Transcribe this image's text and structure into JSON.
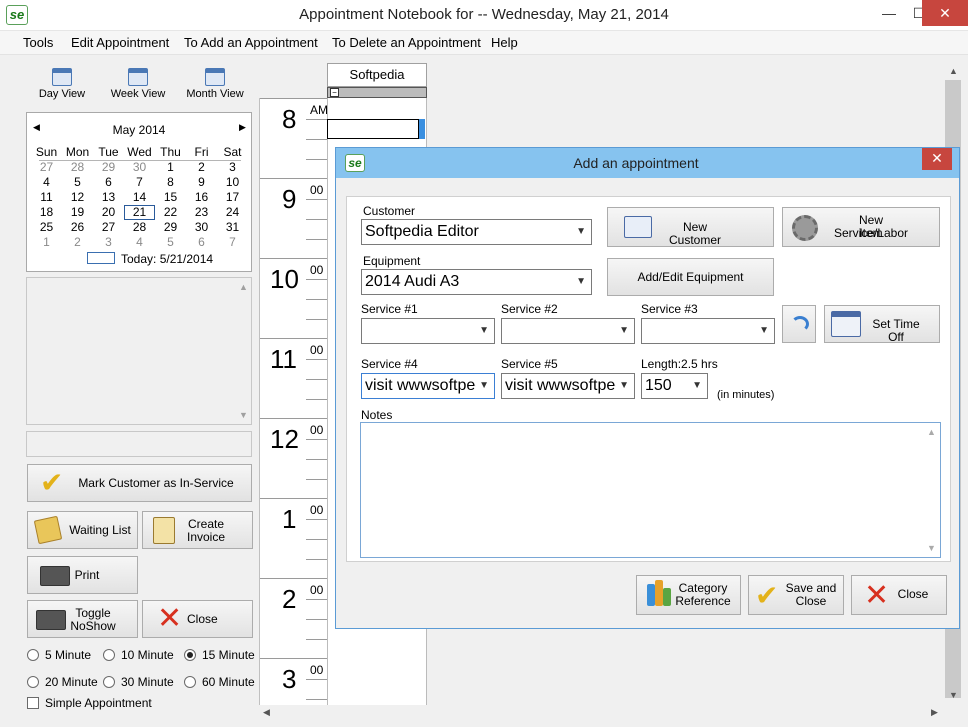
{
  "window": {
    "title": "Appointment Notebook for -- Wednesday, May 21, 2014",
    "logo": "se",
    "minimize": "—",
    "maximize": "☐",
    "close": "✕"
  },
  "menu": [
    "Tools",
    "Edit Appointment",
    "To Add an Appointment",
    "To Delete an Appointment",
    "Help"
  ],
  "views": [
    "Day View",
    "Week View",
    "Month View"
  ],
  "calendar": {
    "title": "May 2014",
    "prev": "◀",
    "next": "▶",
    "weekdays": [
      "Sun",
      "Mon",
      "Tue",
      "Wed",
      "Thu",
      "Fri",
      "Sat"
    ],
    "weeks": [
      [
        "27",
        "28",
        "29",
        "30",
        "1",
        "2",
        "3"
      ],
      [
        "4",
        "5",
        "6",
        "7",
        "8",
        "9",
        "10"
      ],
      [
        "11",
        "12",
        "13",
        "14",
        "15",
        "16",
        "17"
      ],
      [
        "18",
        "19",
        "20",
        "21",
        "22",
        "23",
        "24"
      ],
      [
        "25",
        "26",
        "27",
        "28",
        "29",
        "30",
        "31"
      ],
      [
        "1",
        "2",
        "3",
        "4",
        "5",
        "6",
        "7"
      ]
    ],
    "today_label": "Today: 5/21/2014"
  },
  "left_buttons": {
    "mark_in_service": "Mark Customer as In-Service",
    "waiting_list": "Waiting List",
    "create_invoice_1": "Create",
    "create_invoice_2": "Invoice",
    "print": "Print",
    "toggle_1": "Toggle",
    "toggle_2": "NoShow",
    "close": "Close"
  },
  "intervals": [
    "5 Minute",
    "10 Minute",
    "15 Minute",
    "20 Minute",
    "30 Minute",
    "60 Minute"
  ],
  "selected_interval": "15 Minute",
  "simple_appointment": "Simple Appointment",
  "schedule": {
    "resource": "Softpedia",
    "collapse": "−",
    "hours": [
      {
        "h": "8",
        "m": "AM"
      },
      {
        "h": "9",
        "m": "00"
      },
      {
        "h": "10",
        "m": "00"
      },
      {
        "h": "11",
        "m": "00"
      },
      {
        "h": "12",
        "m": "00"
      },
      {
        "h": "1",
        "m": "00"
      },
      {
        "h": "2",
        "m": "00"
      },
      {
        "h": "3",
        "m": "00"
      }
    ]
  },
  "dialog": {
    "title": "Add an appointment",
    "logo": "se",
    "close": "✕",
    "customer_label": "Customer",
    "customer_value": "Softpedia Editor",
    "equipment_label": "Equipment",
    "equipment_value": "2014 Audi A3",
    "service1_label": "Service #1",
    "service2_label": "Service #2",
    "service3_label": "Service #3",
    "service4_label": "Service #4",
    "service4_value": "visit wwwsoftpedia",
    "service5_label": "Service #5",
    "service5_value": "visit wwwsoftpedia",
    "length_label": "Length:2.5 hrs",
    "length_value": "150",
    "minutes_note": "(in minutes)",
    "notes_label": "Notes",
    "new_customer": "New Customer",
    "new_service_1": "New Service/Labor",
    "new_service_2": "Item",
    "add_edit_equipment": "Add/Edit Equipment",
    "set_time_off": "Set Time Off",
    "category_ref_1": "Category",
    "category_ref_2": "Reference",
    "save_close_1": "Save and",
    "save_close_2": "Close",
    "close_btn": "Close"
  },
  "colors": {
    "dialog_titlebar": "#86c3ef",
    "close_red": "#c7463e",
    "selection_blue": "#3a8fe0"
  },
  "icons": {
    "app_logo": "se-logo-icon",
    "views": "calendar-icon",
    "check": "checkmark-icon",
    "close": "red-x-icon",
    "print": "printer-icon",
    "waiting": "scroll-icon",
    "invoice": "clipboard-icon",
    "new_customer": "address-book-icon",
    "new_service": "gear-icon",
    "refresh": "refresh-arrow-icon",
    "time_off": "calendar-cross-icon",
    "category": "bar-chart-icon"
  }
}
